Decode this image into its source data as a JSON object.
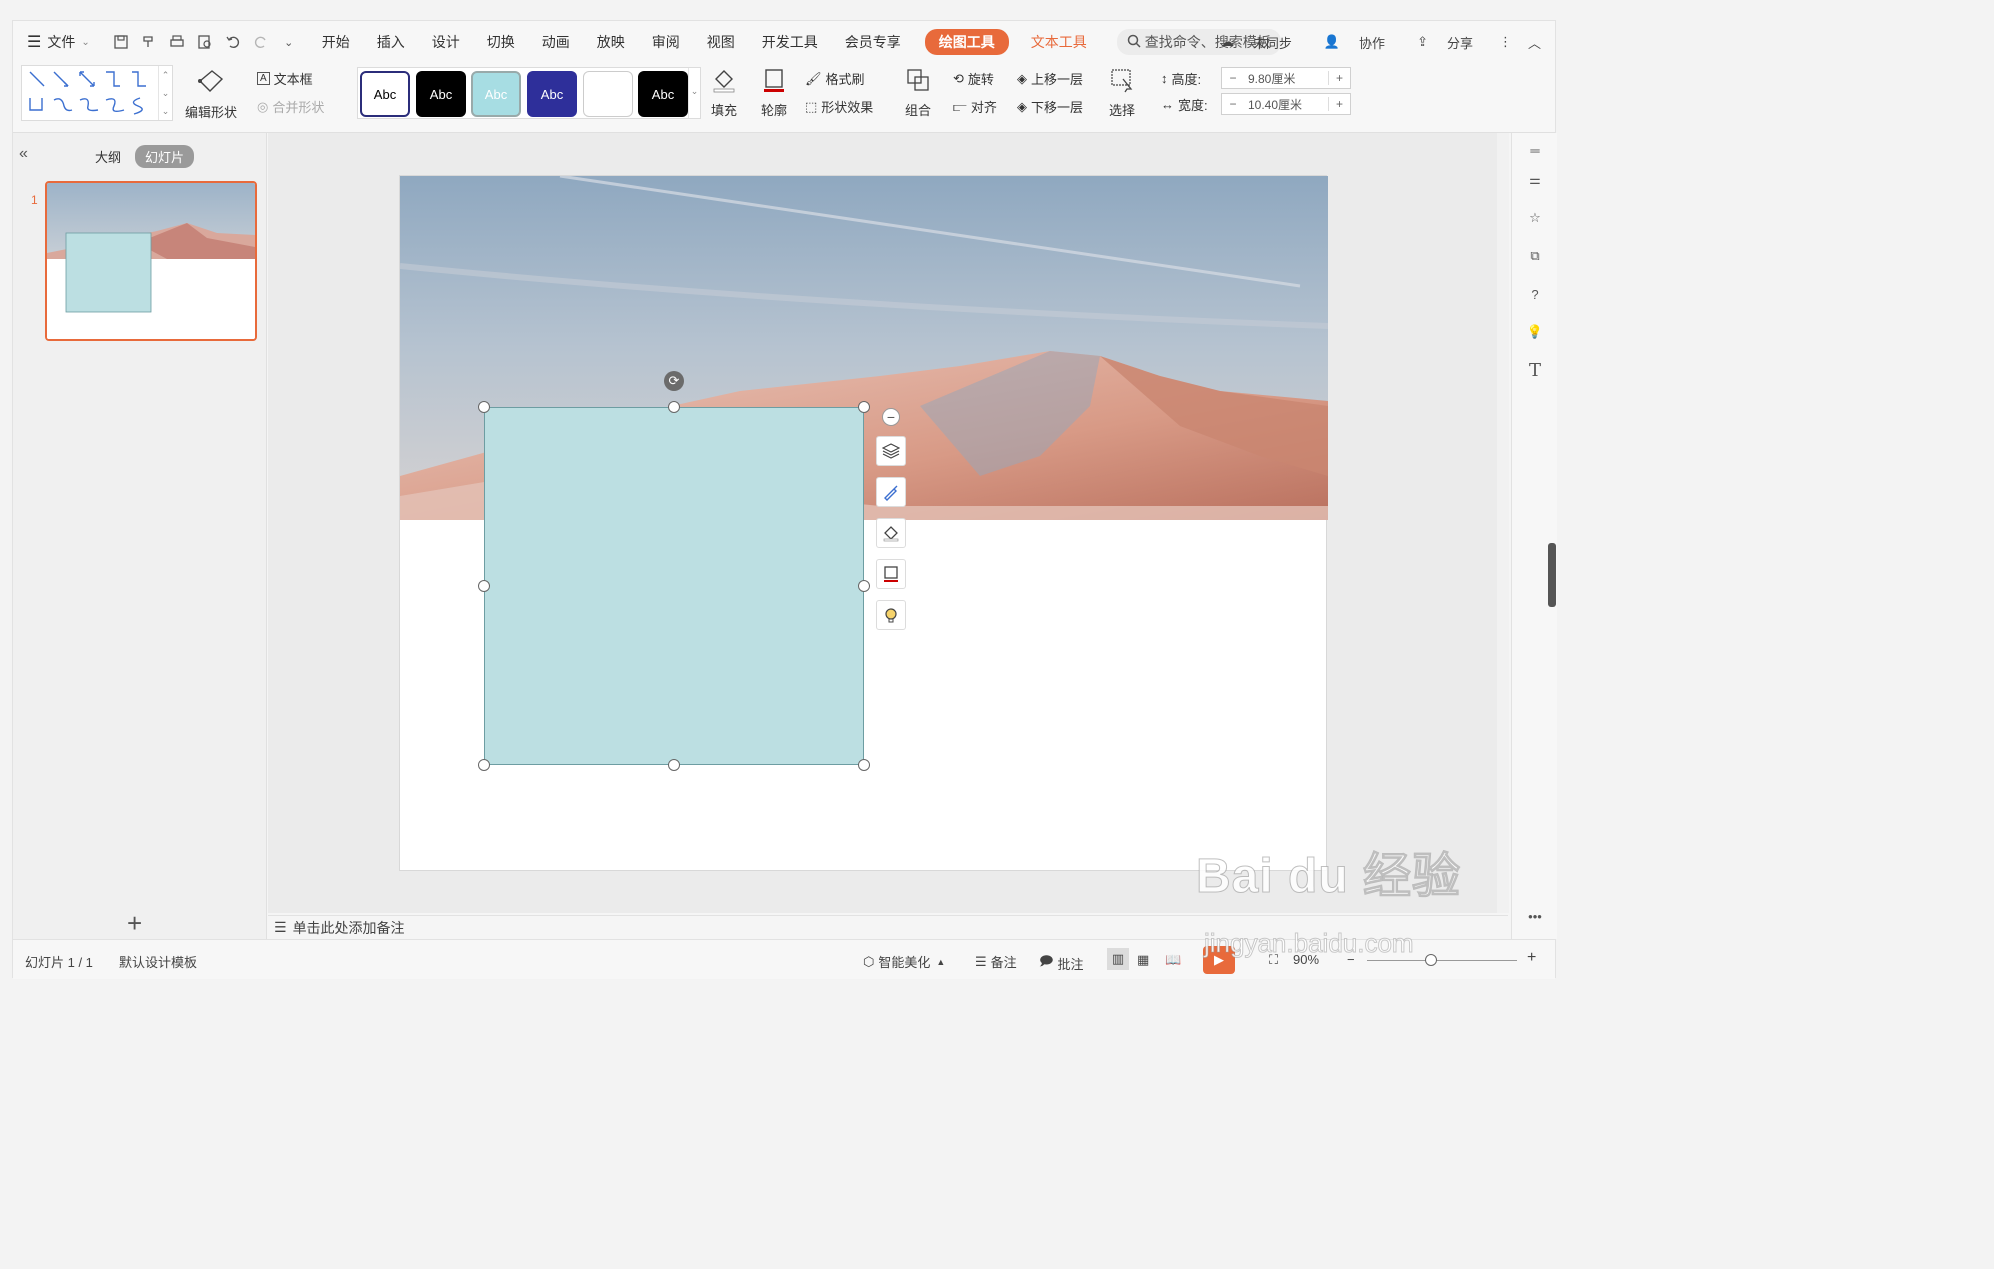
{
  "menubar": {
    "file_label": "文件",
    "tabs": [
      "开始",
      "插入",
      "设计",
      "切换",
      "动画",
      "放映",
      "审阅",
      "视图",
      "开发工具",
      "会员专享"
    ],
    "draw_tools_tab": "绘图工具",
    "text_tools_tab": "文本工具",
    "search_placeholder": "查找命令、搜索模板",
    "unsync": "未同步",
    "collab": "协作",
    "share": "分享"
  },
  "ribbon": {
    "edit_shape": "编辑形状",
    "textbox": "文本框",
    "merge_shape": "合并形状",
    "style_label": "Abc",
    "fill": "填充",
    "outline": "轮廓",
    "format_painter": "格式刷",
    "shape_effect": "形状效果",
    "group": "组合",
    "rotate": "旋转",
    "align": "对齐",
    "bring_forward": "上移一层",
    "send_backward": "下移一层",
    "select": "选择",
    "height_label": "高度:",
    "height_value": "9.80厘米",
    "width_label": "宽度:",
    "width_value": "10.40厘米",
    "minus": "−",
    "plus": "+"
  },
  "leftpanel": {
    "outline_tab": "大纲",
    "slides_tab": "幻灯片",
    "slide_number": "1",
    "add": "+"
  },
  "notes": {
    "placeholder": "单击此处添加备注"
  },
  "statusbar": {
    "slide_info": "幻灯片 1 / 1",
    "template": "默认设计模板",
    "smart_beautify": "智能美化",
    "notes": "备注",
    "comments": "批注",
    "zoom": "90%"
  },
  "watermark": {
    "brand": "Bai du 经验",
    "url": "jingyan.baidu.com"
  },
  "colors": {
    "accent": "#e86a3b",
    "shape_fill": "#bcdfe2"
  }
}
